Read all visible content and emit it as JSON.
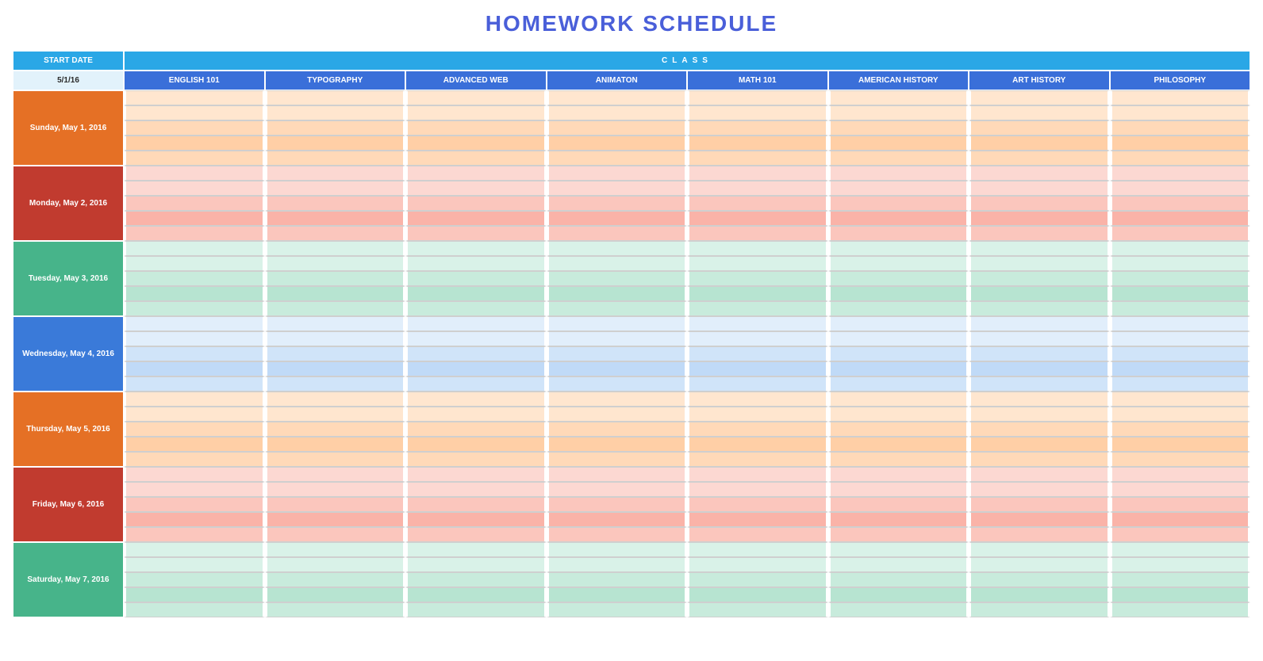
{
  "title": "HOMEWORK SCHEDULE",
  "header": {
    "start_date_label": "START DATE",
    "start_date_value": "5/1/16",
    "class_label": "CLASS"
  },
  "classes": [
    "ENGLISH 101",
    "TYPOGRAPHY",
    "ADVANCED WEB",
    "ANIMATON",
    "MATH 101",
    "AMERICAN HISTORY",
    "ART HISTORY",
    "PHILOSOPHY"
  ],
  "rows_per_day": 5,
  "days": [
    {
      "label": "Sunday, May 1, 2016",
      "bg": "day-bg-orange",
      "slot": "orange"
    },
    {
      "label": "Monday, May 2, 2016",
      "bg": "day-bg-red",
      "slot": "red"
    },
    {
      "label": "Tuesday, May 3, 2016",
      "bg": "day-bg-green",
      "slot": "green"
    },
    {
      "label": "Wednesday, May 4, 2016",
      "bg": "day-bg-blue",
      "slot": "blue"
    },
    {
      "label": "Thursday, May 5, 2016",
      "bg": "day-bg-orange",
      "slot": "orange"
    },
    {
      "label": "Friday, May 6, 2016",
      "bg": "day-bg-red",
      "slot": "red"
    },
    {
      "label": "Saturday, May 7, 2016",
      "bg": "day-bg-green",
      "slot": "green"
    }
  ]
}
